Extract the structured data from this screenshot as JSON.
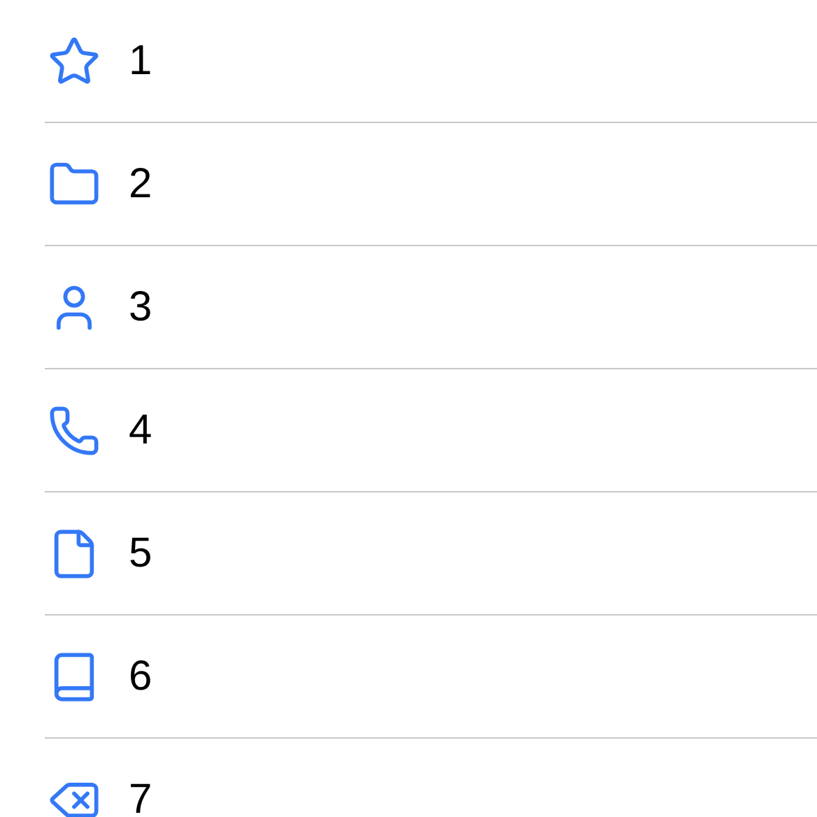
{
  "rows": [
    {
      "kind": "star",
      "label": "1"
    },
    {
      "kind": "folder",
      "label": "2"
    },
    {
      "kind": "person",
      "label": "3"
    },
    {
      "kind": "phone",
      "label": "4"
    },
    {
      "kind": "document",
      "label": "5"
    },
    {
      "kind": "book",
      "label": "6"
    },
    {
      "kind": "delete",
      "label": "7"
    }
  ]
}
